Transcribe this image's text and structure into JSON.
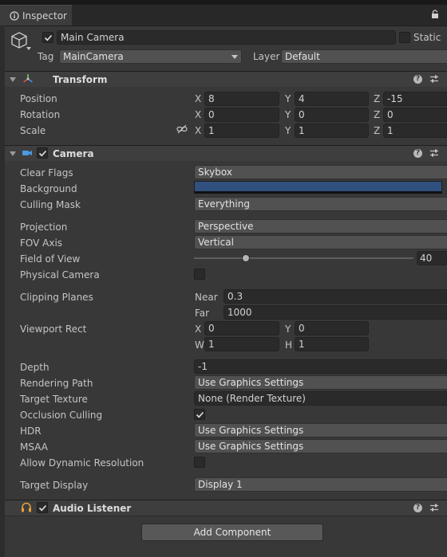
{
  "tab": {
    "title": "Inspector"
  },
  "object": {
    "name": "Main Camera",
    "static_label": "Static",
    "tag_label": "Tag",
    "tag_value": "MainCamera",
    "layer_label": "Layer",
    "layer_value": "Default",
    "active": true
  },
  "transform": {
    "title": "Transform",
    "rows": [
      {
        "label": "Position",
        "x": "8",
        "y": "4",
        "z": "-15"
      },
      {
        "label": "Rotation",
        "x": "0",
        "y": "0",
        "z": "0"
      },
      {
        "label": "Scale",
        "x": "1",
        "y": "1",
        "z": "1"
      }
    ]
  },
  "axes": {
    "x": "X",
    "y": "Y",
    "z": "Z",
    "w": "W",
    "h": "H"
  },
  "camera": {
    "title": "Camera",
    "clear_flags": {
      "label": "Clear Flags",
      "value": "Skybox"
    },
    "background": {
      "label": "Background",
      "color": "#30507f"
    },
    "culling_mask": {
      "label": "Culling Mask",
      "value": "Everything"
    },
    "projection": {
      "label": "Projection",
      "value": "Perspective"
    },
    "fov_axis": {
      "label": "FOV Axis",
      "value": "Vertical"
    },
    "fov": {
      "label": "Field of View",
      "value": "40",
      "slider_fraction": 0.23
    },
    "physical": {
      "label": "Physical Camera",
      "checked": false
    },
    "clipping": {
      "label": "Clipping Planes",
      "near_label": "Near",
      "near": "0.3",
      "far_label": "Far",
      "far": "1000"
    },
    "viewport": {
      "label": "Viewport Rect",
      "x": "0",
      "y": "0",
      "w": "1",
      "h": "1"
    },
    "depth": {
      "label": "Depth",
      "value": "-1"
    },
    "rendering_path": {
      "label": "Rendering Path",
      "value": "Use Graphics Settings"
    },
    "target_texture": {
      "label": "Target Texture",
      "value": "None (Render Texture)"
    },
    "occlusion": {
      "label": "Occlusion Culling",
      "checked": true
    },
    "hdr": {
      "label": "HDR",
      "value": "Use Graphics Settings"
    },
    "msaa": {
      "label": "MSAA",
      "value": "Use Graphics Settings"
    },
    "dynres": {
      "label": "Allow Dynamic Resolution",
      "checked": false
    },
    "target_display": {
      "label": "Target Display",
      "value": "Display 1"
    }
  },
  "audio": {
    "title": "Audio Listener"
  },
  "add_component": "Add Component",
  "icons": {
    "help": "?"
  },
  "colors": {
    "panel": "#383838",
    "field": "#2a2a2a",
    "header": "#3e3e3e",
    "dropdown": "#515151"
  }
}
